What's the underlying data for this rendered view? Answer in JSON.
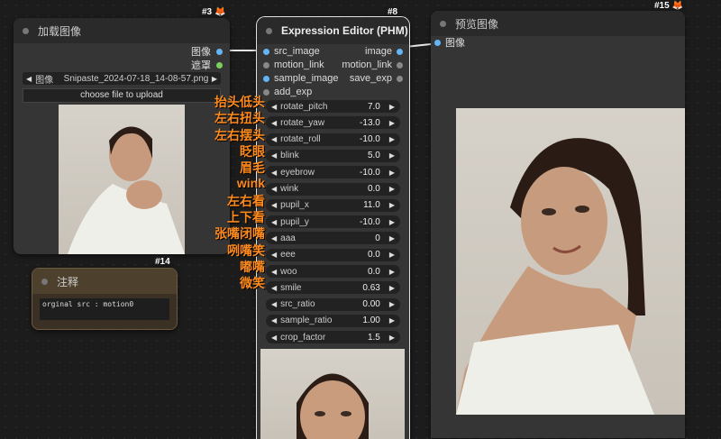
{
  "load_node": {
    "id": "#3",
    "title": "加载图像",
    "outputs": [
      "图像",
      "遮罩"
    ],
    "file_label": "图像",
    "file_value": "Snipaste_2024-07-18_14-08-57.png",
    "upload_label": "choose file to upload"
  },
  "note_node": {
    "id": "#14",
    "title": "注释",
    "text": "orginal src : motion0",
    "accent": "#5a4a30"
  },
  "editor_node": {
    "id": "#8",
    "title": "Expression Editor (PHM)",
    "inputs": [
      "src_image",
      "motion_link",
      "sample_image",
      "add_exp"
    ],
    "outputs": [
      "image",
      "motion_link",
      "save_exp"
    ],
    "widgets": [
      {
        "label": "rotate_pitch",
        "value": "7.0"
      },
      {
        "label": "rotate_yaw",
        "value": "-13.0"
      },
      {
        "label": "rotate_roll",
        "value": "-10.0"
      },
      {
        "label": "blink",
        "value": "5.0"
      },
      {
        "label": "eyebrow",
        "value": "-10.0"
      },
      {
        "label": "wink",
        "value": "0.0"
      },
      {
        "label": "pupil_x",
        "value": "11.0"
      },
      {
        "label": "pupil_y",
        "value": "-10.0"
      },
      {
        "label": "aaa",
        "value": "0"
      },
      {
        "label": "eee",
        "value": "0.0"
      },
      {
        "label": "woo",
        "value": "0.0"
      },
      {
        "label": "smile",
        "value": "0.63"
      },
      {
        "label": "src_ratio",
        "value": "0.00"
      },
      {
        "label": "sample_ratio",
        "value": "1.00"
      },
      {
        "label": "crop_factor",
        "value": "1.5"
      }
    ]
  },
  "preview_node": {
    "id": "#15",
    "title": "预览图像",
    "input": "图像"
  },
  "annotations": [
    "抬头低头",
    "左右扭头",
    "左右摆头",
    "眨眼",
    "眉毛",
    "wink",
    "左右看",
    "上下看",
    "张嘴闭嘴",
    "咧嘴笑",
    "嘟嘴",
    "微笑"
  ],
  "colors": {
    "annotation": "#ff8a1c",
    "port_image": "#64b5f6",
    "port_mask": "#7ccf5c",
    "badge_fox": "#ff7a1a"
  },
  "icons": {
    "badge": "fox-icon"
  }
}
